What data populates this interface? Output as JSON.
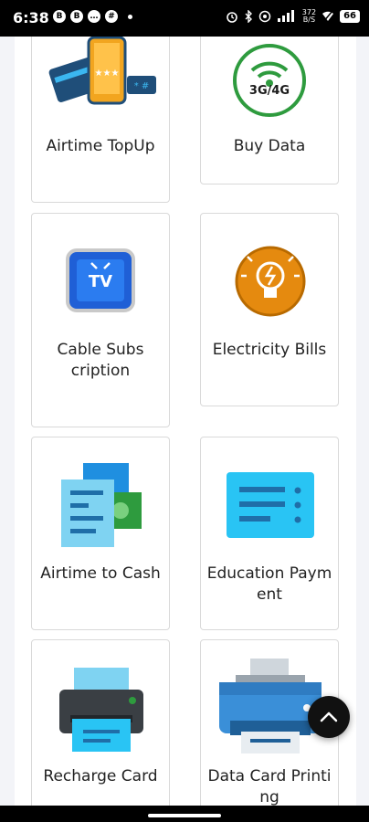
{
  "status_bar": {
    "time": "6:38",
    "notification_icons": [
      "b-circle",
      "b-circle",
      "chat-bubble",
      "slack",
      "dot"
    ],
    "notif_glyphs": [
      "B",
      "B",
      "…",
      "#"
    ],
    "network_speed_top": "372",
    "network_speed_unit": "B/S",
    "battery_level": "66"
  },
  "services": [
    {
      "label": "Airtime TopUp",
      "icon": "airtime-topup-icon"
    },
    {
      "label": "Buy Data",
      "icon": "buy-data-icon",
      "badge_text": "3G/4G"
    },
    {
      "label": "Cable Subscription",
      "icon": "cable-tv-icon",
      "badge_text": "TV"
    },
    {
      "label": "Electricity Bills",
      "icon": "electricity-bulb-icon"
    },
    {
      "label": "Airtime to Cash",
      "icon": "airtime-to-cash-icon"
    },
    {
      "label": "Education Payment",
      "icon": "education-payment-icon"
    },
    {
      "label": "Recharge Card",
      "icon": "recharge-card-printer-icon"
    },
    {
      "label": "Data Card Printing",
      "icon": "data-card-printer-icon"
    }
  ],
  "scroll_top_button": {
    "icon": "chevron-up-icon"
  },
  "colors": {
    "panel": "#ffffff",
    "background": "#f3f4f8",
    "card_border": "#d9d9d9",
    "data_green": "#2e9b3e",
    "tv_blue": "#1f5fd6",
    "bulb_orange": "#e58a0f",
    "cyan": "#29c4f4"
  }
}
